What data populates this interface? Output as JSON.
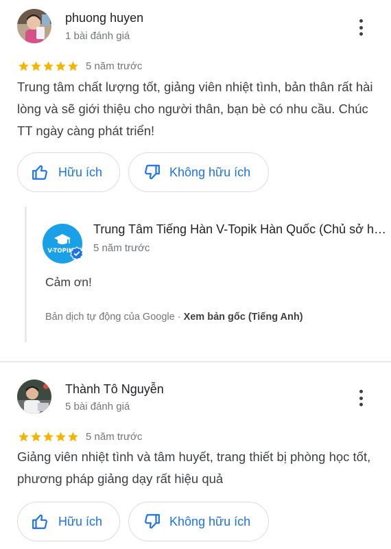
{
  "reviews": [
    {
      "author": "phuong huyen",
      "review_count": "1 bài đánh giá",
      "rating": 5,
      "date": "5 năm trước",
      "text": "Trung tâm chất lượng tốt, giảng viên nhiệt tình, bản thân rất hài lòng và sẽ giới thiệu cho người thân, bạn bè có nhu cầu. Chúc TT ngày càng phát triển!",
      "helpful_label": "Hữu ích",
      "not_helpful_label": "Không hữu ích",
      "owner_reply": {
        "owner_name": "Trung Tâm Tiếng Hàn V-Topik Hàn Quốc (Chủ sở hữu)",
        "logo_text": "V-TOPIK",
        "date": "5 năm trước",
        "text": "Cảm ơn!",
        "translation_note": "Bản dịch tự động của Google · ",
        "view_original": "Xem bản gốc (Tiếng Anh)"
      }
    },
    {
      "author": "Thành Tô Nguyễn",
      "review_count": "5 bài đánh giá",
      "rating": 5,
      "date": "5 năm trước",
      "text": "Giảng viên nhiệt tình và tâm huyết, trang thiết bị phòng học tốt, phương pháp giảng dạy rất hiệu quả",
      "helpful_label": "Hữu ích",
      "not_helpful_label": "Không hữu ích"
    }
  ],
  "colors": {
    "star": "#f4b400",
    "accent": "#1a73e8",
    "logo_bg": "#1aa0e6",
    "verified": "#1a73e8"
  },
  "icons": [
    "avatar-photo",
    "more-vert-icon",
    "star-icon",
    "thumb-up-icon",
    "thumb-down-icon",
    "verified-check-icon"
  ]
}
